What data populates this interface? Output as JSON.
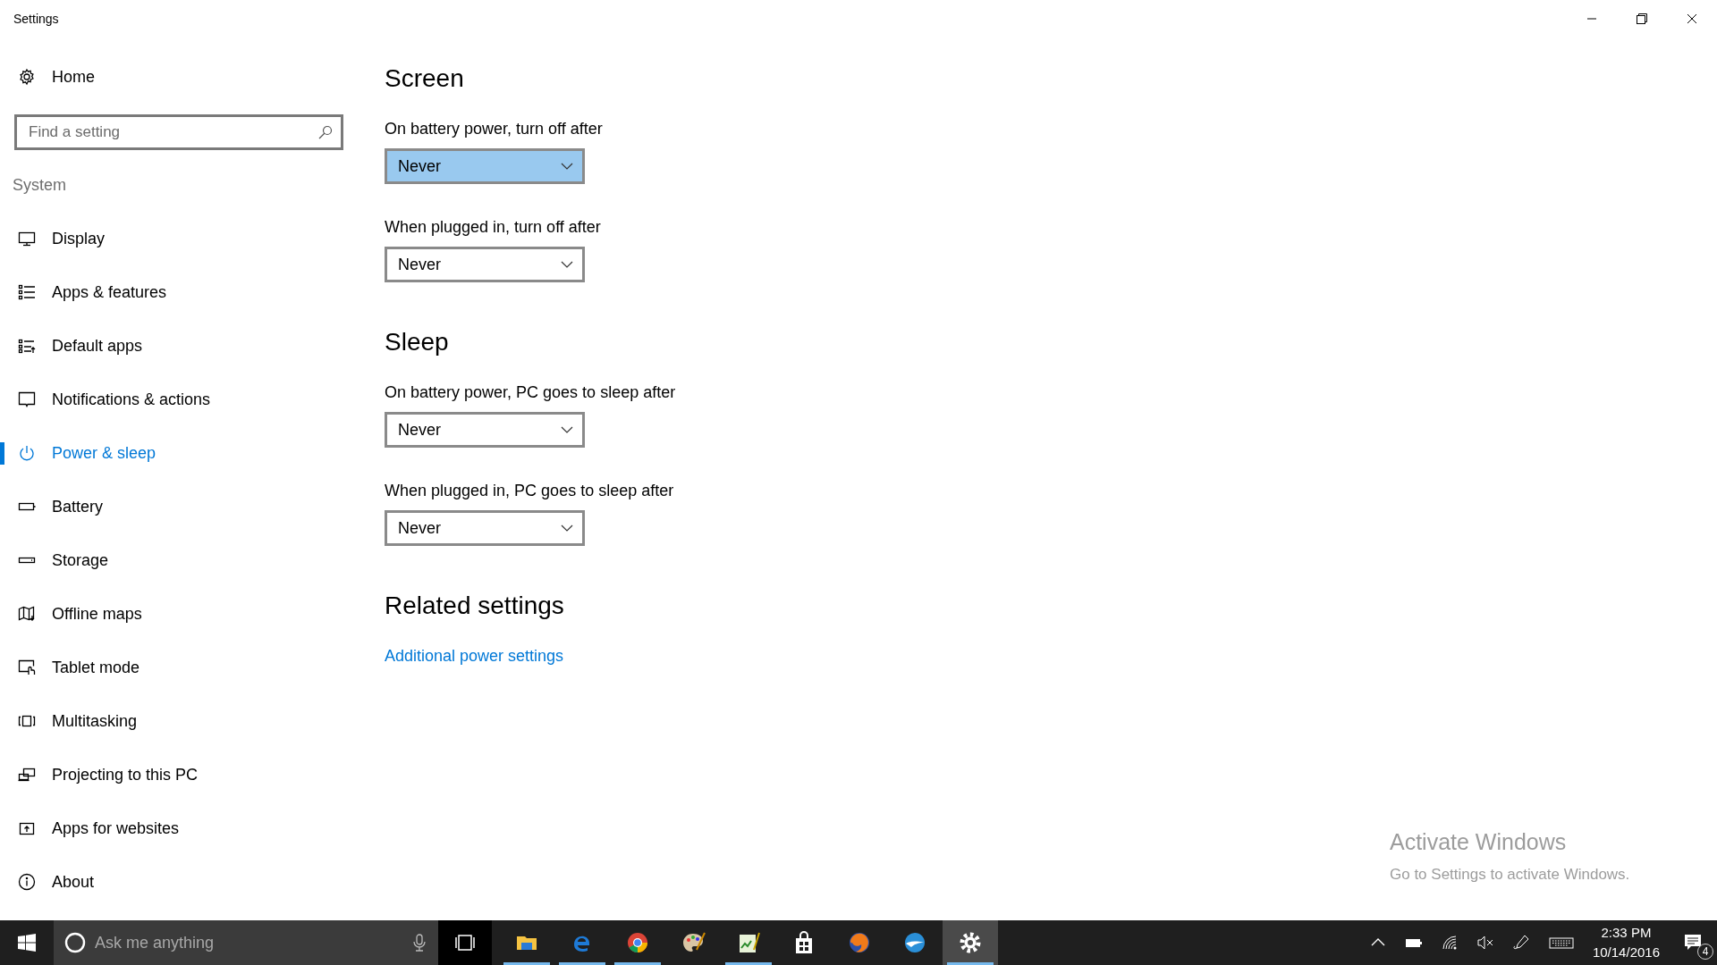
{
  "window": {
    "title": "Settings"
  },
  "sidebar": {
    "home": "Home",
    "search": {
      "placeholder": "Find a setting"
    },
    "section": "System",
    "items": [
      {
        "label": "Display",
        "selected": false
      },
      {
        "label": "Apps & features",
        "selected": false
      },
      {
        "label": "Default apps",
        "selected": false
      },
      {
        "label": "Notifications & actions",
        "selected": false
      },
      {
        "label": "Power & sleep",
        "selected": true
      },
      {
        "label": "Battery",
        "selected": false
      },
      {
        "label": "Storage",
        "selected": false
      },
      {
        "label": "Offline maps",
        "selected": false
      },
      {
        "label": "Tablet mode",
        "selected": false
      },
      {
        "label": "Multitasking",
        "selected": false
      },
      {
        "label": "Projecting to this PC",
        "selected": false
      },
      {
        "label": "Apps for websites",
        "selected": false
      },
      {
        "label": "About",
        "selected": false
      }
    ]
  },
  "sections": [
    {
      "heading": "Screen",
      "settings": [
        {
          "label": "On battery power, turn off after",
          "value": "Never",
          "highlighted": true
        },
        {
          "label": "When plugged in, turn off after",
          "value": "Never",
          "highlighted": false
        }
      ]
    },
    {
      "heading": "Sleep",
      "settings": [
        {
          "label": "On battery power, PC goes to sleep after",
          "value": "Never",
          "highlighted": false
        },
        {
          "label": "When plugged in, PC goes to sleep after",
          "value": "Never",
          "highlighted": false
        }
      ]
    }
  ],
  "related": {
    "heading": "Related settings",
    "link": "Additional power settings"
  },
  "activation_notice": {
    "title": "Activate Windows",
    "text": "Go to Settings to activate Windows."
  },
  "taskbar": {
    "search": {
      "placeholder": "Ask me anything"
    },
    "apps": [
      {
        "running": true,
        "selected": false
      },
      {
        "running": true,
        "selected": false
      },
      {
        "running": true,
        "selected": false
      },
      {
        "running": false,
        "selected": false
      },
      {
        "running": true,
        "selected": false
      },
      {
        "running": false,
        "selected": false
      },
      {
        "running": false,
        "selected": false
      },
      {
        "running": false,
        "selected": false
      },
      {
        "running": true,
        "selected": true
      }
    ],
    "time": "2:33 PM",
    "date": "10/14/2016",
    "notification_count": "4"
  }
}
